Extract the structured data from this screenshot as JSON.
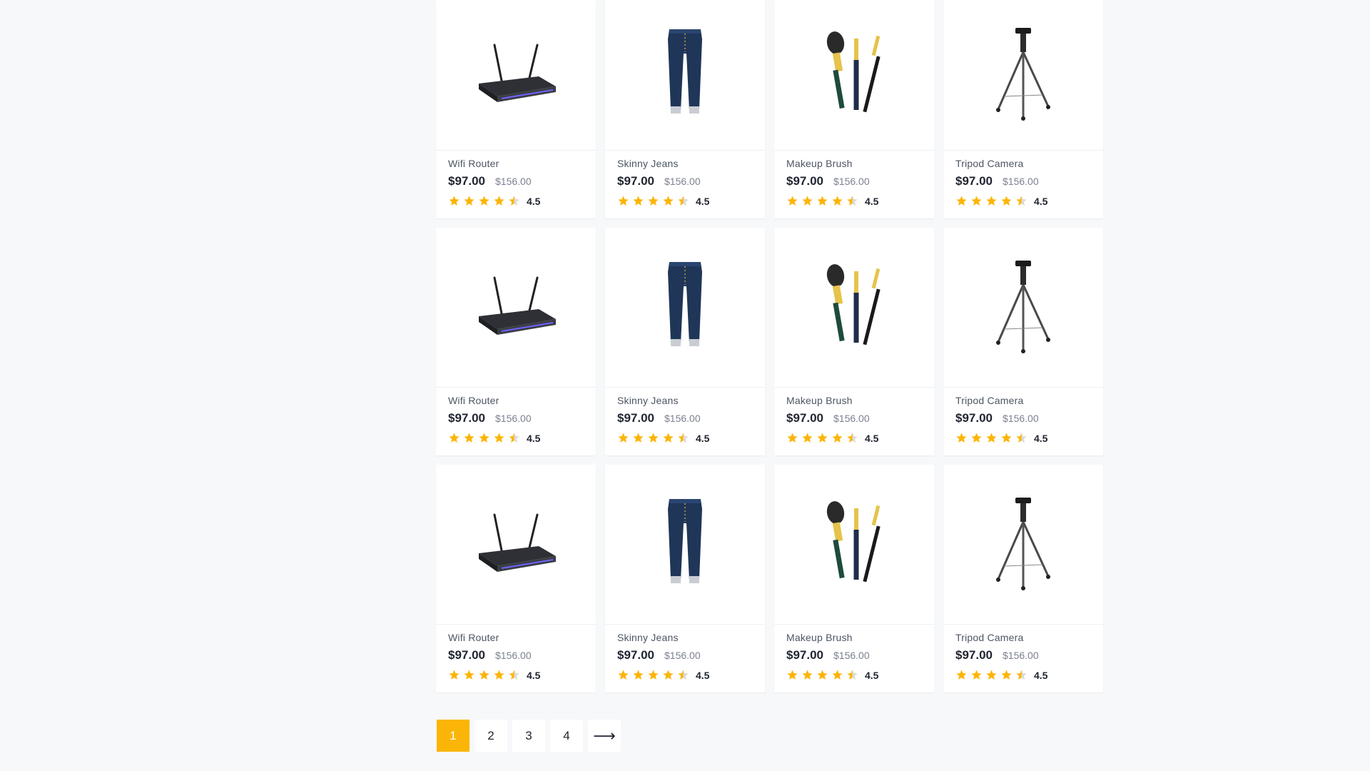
{
  "products": [
    {
      "name": "Wifi Router",
      "price": "$97.00",
      "old_price": "$156.00",
      "rating": "4.5",
      "icon": "wifi-router"
    },
    {
      "name": "Skinny Jeans",
      "price": "$97.00",
      "old_price": "$156.00",
      "rating": "4.5",
      "icon": "jeans"
    },
    {
      "name": "Makeup Brush",
      "price": "$97.00",
      "old_price": "$156.00",
      "rating": "4.5",
      "icon": "makeup-brush"
    },
    {
      "name": "Tripod Camera",
      "price": "$97.00",
      "old_price": "$156.00",
      "rating": "4.5",
      "icon": "tripod"
    },
    {
      "name": "Wifi Router",
      "price": "$97.00",
      "old_price": "$156.00",
      "rating": "4.5",
      "icon": "wifi-router"
    },
    {
      "name": "Skinny Jeans",
      "price": "$97.00",
      "old_price": "$156.00",
      "rating": "4.5",
      "icon": "jeans"
    },
    {
      "name": "Makeup Brush",
      "price": "$97.00",
      "old_price": "$156.00",
      "rating": "4.5",
      "icon": "makeup-brush"
    },
    {
      "name": "Tripod Camera",
      "price": "$97.00",
      "old_price": "$156.00",
      "rating": "4.5",
      "icon": "tripod"
    },
    {
      "name": "Wifi Router",
      "price": "$97.00",
      "old_price": "$156.00",
      "rating": "4.5",
      "icon": "wifi-router"
    },
    {
      "name": "Skinny Jeans",
      "price": "$97.00",
      "old_price": "$156.00",
      "rating": "4.5",
      "icon": "jeans"
    },
    {
      "name": "Makeup Brush",
      "price": "$97.00",
      "old_price": "$156.00",
      "rating": "4.5",
      "icon": "makeup-brush"
    },
    {
      "name": "Tripod Camera",
      "price": "$97.00",
      "old_price": "$156.00",
      "rating": "4.5",
      "icon": "tripod"
    }
  ],
  "pagination": {
    "pages": [
      "1",
      "2",
      "3",
      "4"
    ],
    "active": "1",
    "next_label": "⟶"
  },
  "colors": {
    "accent": "#fbb506",
    "star": "#fbb506"
  }
}
